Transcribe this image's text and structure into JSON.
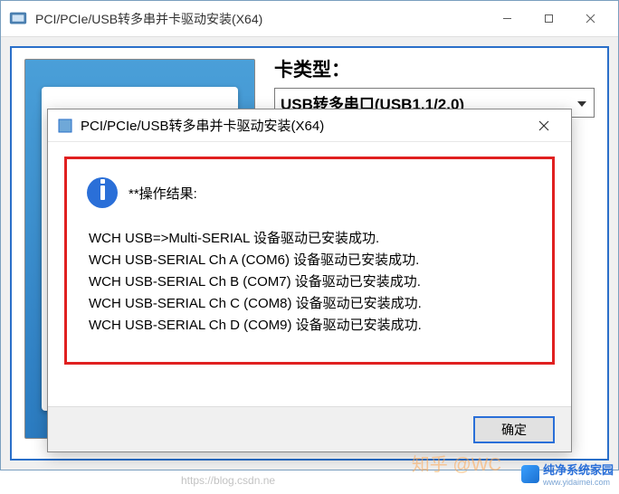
{
  "parent": {
    "title": "PCI/PCIe/USB转多串并卡驱动安装(X64)"
  },
  "card_type": {
    "label": "卡类型：",
    "value": "USB转多串口(USB1.1/2.0)"
  },
  "dialog": {
    "title": "PCI/PCIe/USB转多串并卡驱动安装(X64)",
    "result_header": "**操作结果:",
    "lines": [
      "WCH USB=>Multi-SERIAL 设备驱动已安装成功.",
      "WCH USB-SERIAL Ch A (COM6) 设备驱动已安装成功.",
      "WCH USB-SERIAL Ch B (COM7) 设备驱动已安装成功.",
      "WCH USB-SERIAL Ch C (COM8) 设备驱动已安装成功.",
      "WCH USB-SERIAL Ch D (COM9) 设备驱动已安装成功."
    ],
    "ok_label": "确定"
  },
  "watermarks": {
    "zhihu": "知乎 @WC",
    "csdn": "https://blog.csdn.ne",
    "brand": "纯净系统家园",
    "brand_url": "www.yidaimei.com"
  }
}
